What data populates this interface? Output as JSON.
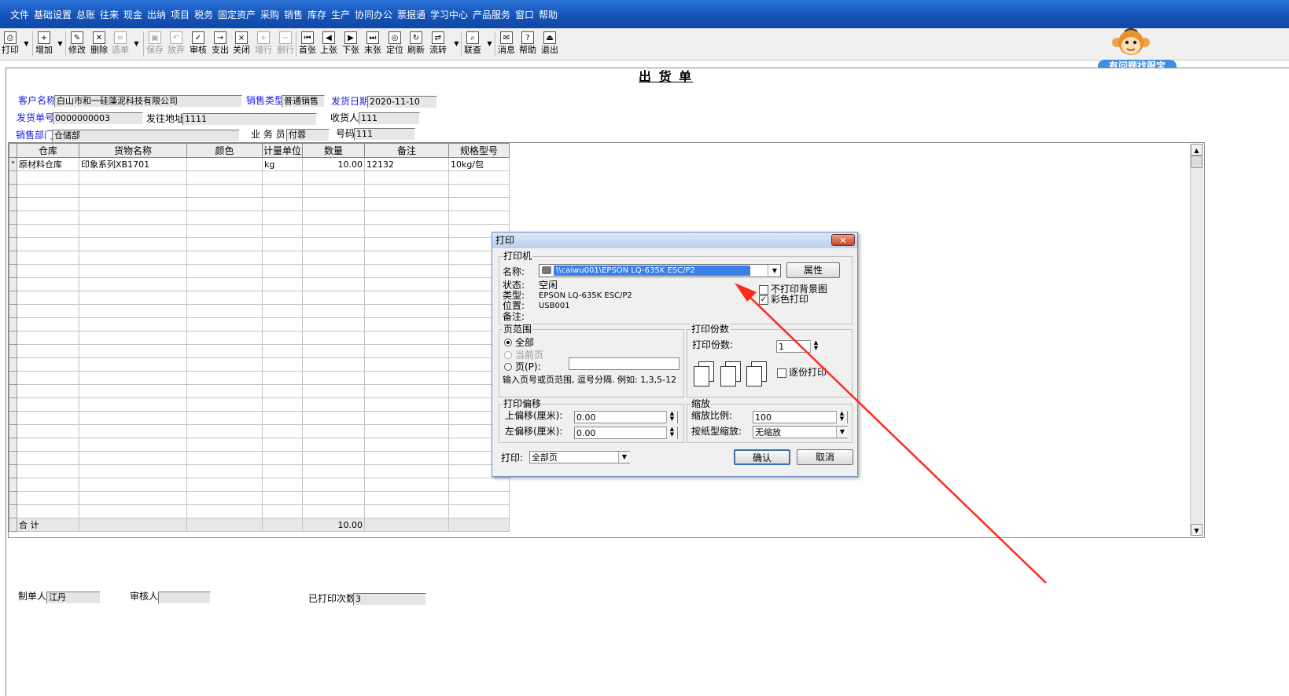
{
  "menu": [
    "文件",
    "基础设置",
    "总账",
    "往来",
    "现金",
    "出纳",
    "项目",
    "税务",
    "固定资产",
    "采购",
    "销售",
    "库存",
    "生产",
    "协同办公",
    "票据通",
    "学习中心",
    "产品服务",
    "窗口",
    "帮助"
  ],
  "toolbar": [
    {
      "label": "打印",
      "icon": "printer-icon",
      "enabled": true
    },
    {
      "label": "增加",
      "icon": "new-document-icon",
      "enabled": true
    },
    {
      "label": "修改",
      "icon": "edit-icon",
      "enabled": true
    },
    {
      "label": "删除",
      "icon": "delete-x-icon",
      "enabled": true
    },
    {
      "label": "选单",
      "icon": "select-document-icon",
      "enabled": false
    },
    {
      "label": "保存",
      "icon": "save-disk-icon",
      "enabled": false
    },
    {
      "label": "放弃",
      "icon": "undo-icon",
      "enabled": false
    },
    {
      "label": "审核",
      "icon": "approve-icon",
      "enabled": true
    },
    {
      "label": "支出",
      "icon": "expense-icon",
      "enabled": true
    },
    {
      "label": "关闭",
      "icon": "close-document-icon",
      "enabled": true
    },
    {
      "label": "增行",
      "icon": "add-row-icon",
      "enabled": false
    },
    {
      "label": "删行",
      "icon": "delete-row-icon",
      "enabled": false
    },
    {
      "label": "首张",
      "icon": "first-record-icon",
      "enabled": true
    },
    {
      "label": "上张",
      "icon": "previous-record-icon",
      "enabled": true
    },
    {
      "label": "下张",
      "icon": "next-record-icon",
      "enabled": true
    },
    {
      "label": "末张",
      "icon": "last-record-icon",
      "enabled": true
    },
    {
      "label": "定位",
      "icon": "locate-icon",
      "enabled": true
    },
    {
      "label": "刷新",
      "icon": "refresh-icon",
      "enabled": true
    },
    {
      "label": "流转",
      "icon": "workflow-icon",
      "enabled": true
    },
    {
      "label": "联查",
      "icon": "linked-query-icon",
      "enabled": true
    },
    {
      "label": "消息",
      "icon": "message-icon",
      "enabled": true
    },
    {
      "label": "帮助",
      "icon": "help-icon",
      "enabled": true
    },
    {
      "label": "退出",
      "icon": "exit-door-icon",
      "enabled": true
    }
  ],
  "service_badge": "有问题找服宝",
  "form": {
    "title": "出 货 单",
    "customer_label": "客户名称",
    "customer": "白山市和一硅藻泥科技有限公司",
    "sales_type_label": "销售类型",
    "sales_type": "普通销售",
    "ship_date_label": "发货日期",
    "ship_date": "2020-11-10",
    "ship_no_label": "发货单号",
    "ship_no": "0000000003",
    "address_label": "发往地址",
    "address": "1111",
    "receiver_label": "收货人",
    "receiver": "111",
    "dept_label": "销售部门",
    "dept": "仓储部",
    "salesman_label": "业 务 员",
    "salesman": "付蓉",
    "code_label": "号码",
    "code": "111",
    "maker_label": "制单人",
    "maker": "江丹",
    "auditor_label": "审核人",
    "auditor": "",
    "print_count_label": "已打印次数",
    "print_count": "3"
  },
  "grid": {
    "columns": [
      "仓库",
      "货物名称",
      "颜色",
      "计量单位",
      "数量",
      "备注",
      "规格型号"
    ],
    "rows": [
      [
        "原材料仓库",
        "印象系列XB1701",
        "",
        "kg",
        "10.00",
        "12132",
        "10kg/包"
      ]
    ],
    "row_marker": "*",
    "total_label": "合  计",
    "total_qty": "10.00"
  },
  "dialog": {
    "title": "打印",
    "printer_group": "打印机",
    "name_label": "名称:",
    "printer_name": "\\\\caiwu001\\EPSON LQ-635K ESC/P2",
    "properties_button": "属性",
    "status_label": "状态:",
    "status": "空闲",
    "type_label": "类型:",
    "type": "EPSON LQ-635K ESC/P2",
    "location_label": "位置:",
    "location": "USB001",
    "comment_label": "备注:",
    "comment": "",
    "no_background_label": "不打印背景图",
    "no_background_checked": false,
    "color_print_label": "彩色打印",
    "color_print_checked": true,
    "range_group": "页范围",
    "range_all": "全部",
    "range_current": "当前页",
    "range_pages": "页(P):",
    "range_hint": "输入页号或页范围, 逗号分隔. 例如: 1,3,5-12",
    "copies_group": "打印份数",
    "copies_label": "打印份数:",
    "copies": "1",
    "collate_label": "逐份打印",
    "collate_checked": false,
    "offset_group": "打印偏移",
    "top_offset_label": "上偏移(厘米):",
    "top_offset": "0.00",
    "left_offset_label": "左偏移(厘米):",
    "left_offset": "0.00",
    "zoom_group": "缩放",
    "zoom_ratio_label": "缩放比例:",
    "zoom_ratio": "100",
    "fit_label": "按纸型缩放:",
    "fit_value": "无缩放",
    "print_label": "打印:",
    "print_value": "全部页",
    "ok_button": "确认",
    "cancel_button": "取消"
  },
  "colors": {
    "menubar": "#1554b9",
    "label_blue": "#1a1ae6",
    "arrow": "#ff2a1a",
    "selection": "#3a7ee8"
  }
}
